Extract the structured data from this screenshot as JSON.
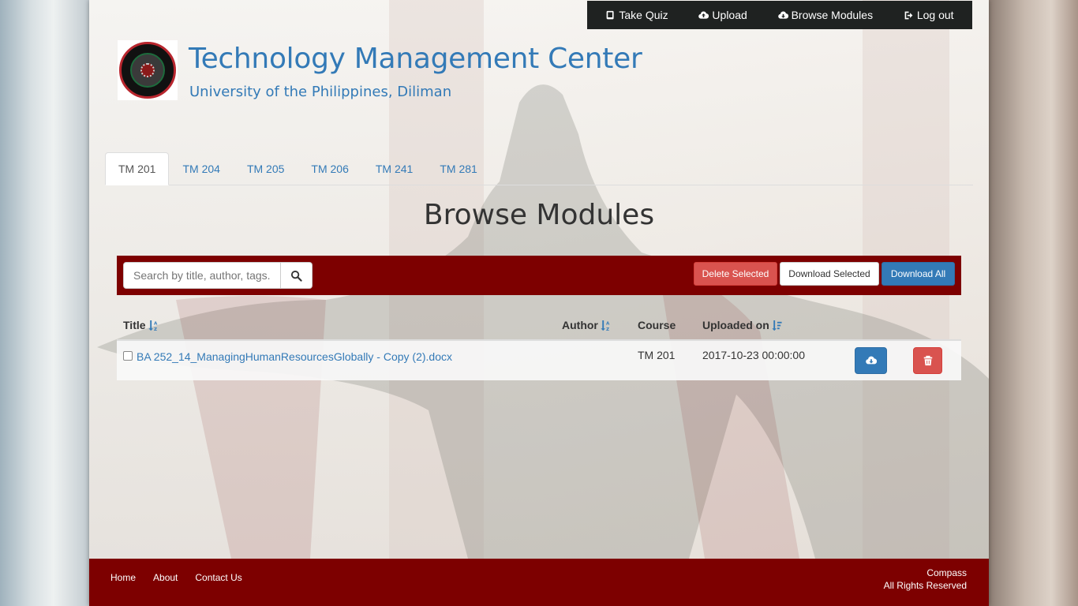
{
  "topnav": {
    "items": [
      {
        "label": "Take Quiz",
        "icon": "book-icon"
      },
      {
        "label": "Upload",
        "icon": "cloud-upload-icon"
      },
      {
        "label": "Browse Modules",
        "icon": "cloud-download-icon"
      },
      {
        "label": "Log out",
        "icon": "logout-icon"
      }
    ]
  },
  "header": {
    "title": "Technology Management Center",
    "subtitle": "University of the Philippines, Diliman"
  },
  "tabs": [
    {
      "label": "TM 201",
      "active": true
    },
    {
      "label": "TM 204",
      "active": false
    },
    {
      "label": "TM 205",
      "active": false
    },
    {
      "label": "TM 206",
      "active": false
    },
    {
      "label": "TM 241",
      "active": false
    },
    {
      "label": "TM 281",
      "active": false
    }
  ],
  "main": {
    "heading": "Browse Modules",
    "search": {
      "placeholder": "Search by title, author, tags.",
      "value": ""
    },
    "buttons": {
      "delete_selected": "Delete Selected",
      "download_selected": "Download Selected",
      "download_all": "Download All"
    }
  },
  "table": {
    "columns": {
      "title": "Title",
      "author": "Author",
      "course": "Course",
      "uploaded_on": "Uploaded on"
    },
    "rows": [
      {
        "title": "BA 252_14_ManagingHumanResourcesGlobally - Copy (2).docx",
        "author": "",
        "course": "TM 201",
        "uploaded_on": "2017-10-23 00:00:00",
        "selected": false
      }
    ]
  },
  "footer": {
    "links": [
      "Home",
      "About",
      "Contact Us"
    ],
    "brand": "Compass",
    "rights": "All Rights Reserved"
  },
  "colors": {
    "brand_red": "#7d0000",
    "link_blue": "#337ab7",
    "danger": "#d9534f",
    "nav_dark": "#1f2221"
  }
}
